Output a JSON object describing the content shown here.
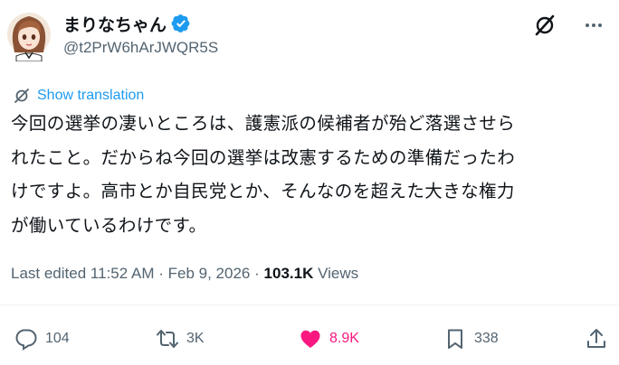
{
  "author": {
    "display_name": "まりなちゃん",
    "handle": "@t2PrW6hArJWQR5S",
    "verified": true
  },
  "translate_label": "Show translation",
  "tweet_text": "今回の選挙の凄いところは、護憲派の候補者が殆ど落選させら\nれたこと。だからね今回の選挙は改憲するための準備だったわ\nけですよ。高市とか自民党とか、そんなのを超えた大きな権力\nが働いているわけです。",
  "meta": {
    "edited_label": "Last edited",
    "time": "11:52 AM",
    "separator": "·",
    "date": "Feb 9, 2026",
    "views_count": "103.1K",
    "views_label": "Views"
  },
  "actions": {
    "replies": "104",
    "reposts": "3K",
    "likes": "8.9K",
    "bookmarks": "338"
  },
  "colors": {
    "accent": "#1d9bf0",
    "like": "#f91880",
    "muted": "#536471",
    "text": "#0f1419"
  },
  "icons": [
    "avatar",
    "verified-badge-icon",
    "grok-icon",
    "more-icon",
    "translate-icon",
    "reply-icon",
    "repost-icon",
    "like-icon",
    "bookmark-icon",
    "share-icon"
  ]
}
